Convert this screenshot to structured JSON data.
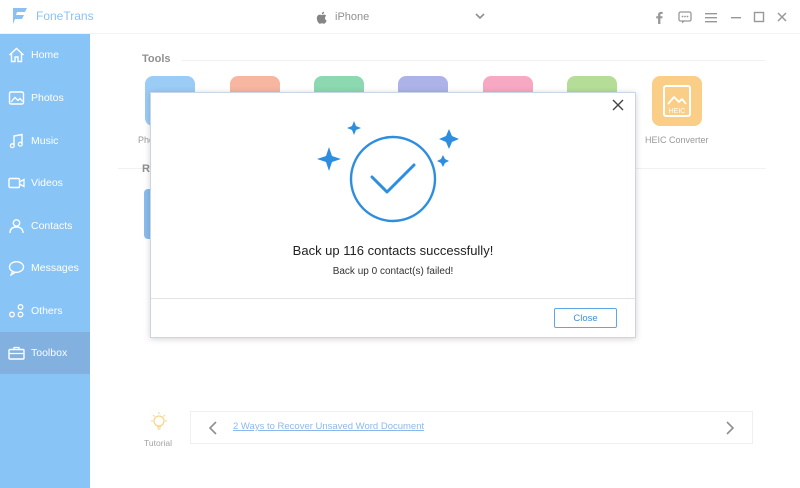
{
  "app": {
    "name": "FoneTrans"
  },
  "device": {
    "name": "iPhone"
  },
  "sidebar": {
    "items": [
      {
        "label": "Home"
      },
      {
        "label": "Photos"
      },
      {
        "label": "Music"
      },
      {
        "label": "Videos"
      },
      {
        "label": "Contacts"
      },
      {
        "label": "Messages"
      },
      {
        "label": "Others"
      },
      {
        "label": "Toolbox"
      }
    ]
  },
  "toolbox": {
    "section_title": "Tools",
    "section2_title_partial": "R",
    "tools": [
      {
        "label": "Pho",
        "icon": "photo-transfer-icon",
        "color": "#4aa3ee"
      },
      {
        "label": "",
        "icon": "tool-orange-icon",
        "color": "#f07a53"
      },
      {
        "label": "",
        "icon": "tool-green-icon",
        "color": "#2eb872"
      },
      {
        "label": "",
        "icon": "tool-purple-icon",
        "color": "#6a74d8"
      },
      {
        "label": "",
        "icon": "tool-pink-icon",
        "color": "#f06292"
      },
      {
        "label": "",
        "icon": "tool-lime-icon",
        "color": "#7ac143"
      },
      {
        "label": "HEIC Converter",
        "icon": "heic-converter-icon",
        "color": "#f6a623"
      }
    ],
    "heic_badge": "HEIC"
  },
  "tutorial": {
    "label": "Tutorial",
    "link_text": "2 Ways to Recover Unsaved Word Document"
  },
  "dialog": {
    "title": "Back up 116 contacts successfully!",
    "subtitle": "Back up 0 contact(s) failed!",
    "close_button": "Close",
    "accent": "#2d8ee0"
  }
}
